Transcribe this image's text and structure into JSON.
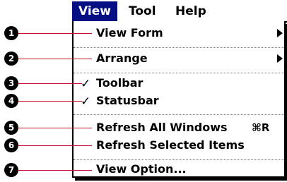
{
  "menubar": {
    "items": [
      {
        "label": "View"
      },
      {
        "label": "Tool"
      },
      {
        "label": "Help"
      }
    ]
  },
  "menu": {
    "items": [
      {
        "label": "View Form",
        "callout": "1"
      },
      {
        "label": "Arrange",
        "callout": "2"
      },
      {
        "label": "Toolbar",
        "callout": "3",
        "checked": true
      },
      {
        "label": "Statusbar",
        "callout": "4",
        "checked": true
      },
      {
        "label": "Refresh All Windows",
        "shortcut": "⌘R",
        "callout": "5"
      },
      {
        "label": "Refresh Selected Items",
        "callout": "6"
      },
      {
        "label": "View Option...",
        "callout": "7"
      }
    ],
    "check_glyph": "✓"
  },
  "colors": {
    "menubar_active": "#060e84",
    "leader_line": "#c8102e"
  }
}
